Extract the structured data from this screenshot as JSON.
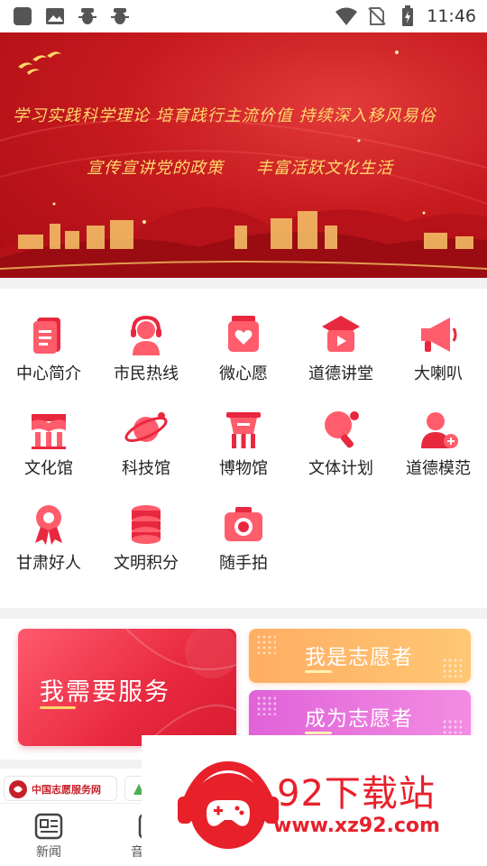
{
  "status_bar": {
    "time": "11:46",
    "left_icons": [
      "app-square-icon",
      "image-icon",
      "bug-icon",
      "bug-icon"
    ],
    "right_icons": [
      "wifi-icon",
      "no-sim-icon",
      "battery-charging-icon"
    ]
  },
  "banner": {
    "line1": "学习实践科学理论  培育践行主流价值  持续深入移风易俗",
    "line2_left": "宣传宣讲党的政策",
    "line2_right": "丰富活跃文化生活"
  },
  "grid": {
    "items": [
      {
        "label": "中心简介",
        "icon": "document-icon"
      },
      {
        "label": "市民热线",
        "icon": "headset-icon"
      },
      {
        "label": "微心愿",
        "icon": "heart-box-icon"
      },
      {
        "label": "道德讲堂",
        "icon": "video-play-icon"
      },
      {
        "label": "大喇叭",
        "icon": "megaphone-icon"
      },
      {
        "label": "文化馆",
        "icon": "book-building-icon"
      },
      {
        "label": "科技馆",
        "icon": "planet-icon"
      },
      {
        "label": "博物馆",
        "icon": "ancient-vessel-icon"
      },
      {
        "label": "文体计划",
        "icon": "ping-pong-icon"
      },
      {
        "label": "道德模范",
        "icon": "person-plus-icon"
      },
      {
        "label": "甘肃好人",
        "icon": "award-ribbon-icon"
      },
      {
        "label": "文明积分",
        "icon": "coin-stack-icon"
      },
      {
        "label": "随手拍",
        "icon": "camera-icon"
      }
    ]
  },
  "services": {
    "need_service": "我需要服务",
    "i_am_volunteer": "我是志愿者",
    "become_volunteer": "成为志愿者"
  },
  "partners": {
    "first": "中国志愿服务网"
  },
  "bottom_nav": {
    "items": [
      {
        "label": "新闻",
        "icon": "news-icon"
      },
      {
        "label": "音",
        "icon": "audio-icon"
      }
    ]
  },
  "watermark": {
    "title": "92下载站",
    "url": "www.xz92.com"
  },
  "colors": {
    "primary_red": "#e8283e",
    "banner_red": "#c71a1f",
    "gold_text": "#ffd86b",
    "orange_card": "#ffad62",
    "purple_card": "#e063d8"
  }
}
